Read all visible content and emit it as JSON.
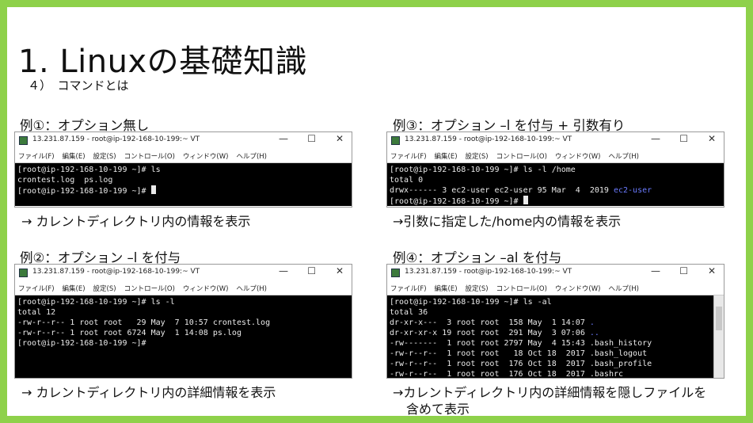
{
  "slide": {
    "title": "1. Linuxの基礎知識",
    "subtitle": "４）　コマンドとは"
  },
  "window_common": {
    "title": "13.231.87.159 - root@ip-192-168-10-199:~ VT",
    "menu": [
      "ファイル(F)",
      "編集(E)",
      "設定(S)",
      "コントロール(O)",
      "ウィンドウ(W)",
      "ヘルプ(H)"
    ],
    "controls": {
      "minimize": "—",
      "maximize": "☐",
      "close": "✕"
    }
  },
  "examples": [
    {
      "label": "例①：オプション無し",
      "lines": [
        "[root@ip-192-168-10-199 ~]# ls",
        "crontest.log  ps.log",
        "[root@ip-192-168-10-199 ~]# "
      ],
      "caption": "→ カレントディレクトリ内の情報を表示"
    },
    {
      "label": "例②：オプション –l を付与",
      "lines": [
        "[root@ip-192-168-10-199 ~]# ls -l",
        "total 12",
        "-rw-r--r-- 1 root root   29 May  7 10:57 crontest.log",
        "-rw-r--r-- 1 root root 6724 May  1 14:08 ps.log",
        "[root@ip-192-168-10-199 ~]#"
      ],
      "caption": "→ カレントディレクトリ内の詳細情報を表示"
    },
    {
      "label": "例③：オプション –l を付与 + 引数有り",
      "lines": [
        "[root@ip-192-168-10-199 ~]# ls -l /home",
        "total 0",
        "drwx------ 3 ec2-user ec2-user 95 Mar  4  2019 ",
        "[root@ip-192-168-10-199 ~]# "
      ],
      "dir_name": "ec2-user",
      "caption": "→引数に指定した/home内の情報を表示"
    },
    {
      "label": "例④：オプション –al を付与",
      "lines": [
        "[root@ip-192-168-10-199 ~]# ls -al",
        "total 36",
        "dr-xr-x---  3 root root  158 May  1 14:07 ",
        "dr-xr-xr-x 19 root root  291 May  3 07:06 ",
        "-rw-------  1 root root 2797 May  4 15:43 .bash_history",
        "-rw-r--r--  1 root root   18 Oct 18  2017 .bash_logout",
        "-rw-r--r--  1 root root  176 Oct 18  2017 .bash_profile",
        "-rw-r--r--  1 root root  176 Oct 18  2017 .bashrc"
      ],
      "dot": ".",
      "dotdot": "..",
      "caption_line1": "→カレントディレクトリ内の詳細情報を隠しファイルを",
      "caption_line2": "含めて表示"
    }
  ]
}
